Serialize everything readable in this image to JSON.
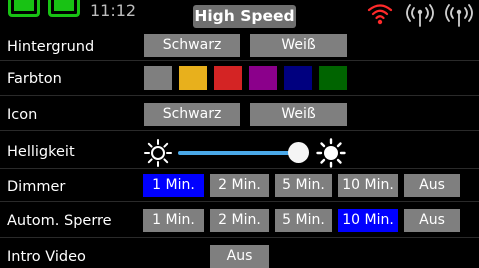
{
  "status_bar": {
    "time": "11:12",
    "mode": "High Speed",
    "icons": [
      "battery-icon",
      "battery-icon",
      "wifi-icon",
      "antenna-signal-icon",
      "antenna-signal-icon"
    ]
  },
  "colors": {
    "background": "#000000",
    "button_inactive": "#7f7f7f",
    "button_active": "#0000ff",
    "battery_green": "#18c214",
    "wifi_red": "#ff2a2a"
  },
  "settings": {
    "background": {
      "label": "Hintergrund",
      "options": [
        "Schwarz",
        "Weiß"
      ]
    },
    "color_tone": {
      "label": "Farbton",
      "swatches": [
        "#7f7f7f",
        "#e8b01c",
        "#d42424",
        "#8b008b",
        "#00007f",
        "#006400"
      ]
    },
    "icon": {
      "label": "Icon",
      "options": [
        "Schwarz",
        "Weiß"
      ]
    },
    "brightness": {
      "label": "Helligkeit",
      "level_fraction": 1.0
    },
    "dimmer": {
      "label": "Dimmer",
      "options": [
        "1 Min.",
        "2 Min.",
        "5 Min.",
        "10 Min.",
        "Aus"
      ],
      "selected": "1 Min."
    },
    "auto_lock": {
      "label": "Autom. Sperre",
      "options": [
        "1 Min.",
        "2 Min.",
        "5 Min.",
        "10 Min.",
        "Aus"
      ],
      "selected": "10 Min."
    },
    "intro_video": {
      "label": "Intro Video",
      "options": [
        "Aus"
      ]
    }
  }
}
